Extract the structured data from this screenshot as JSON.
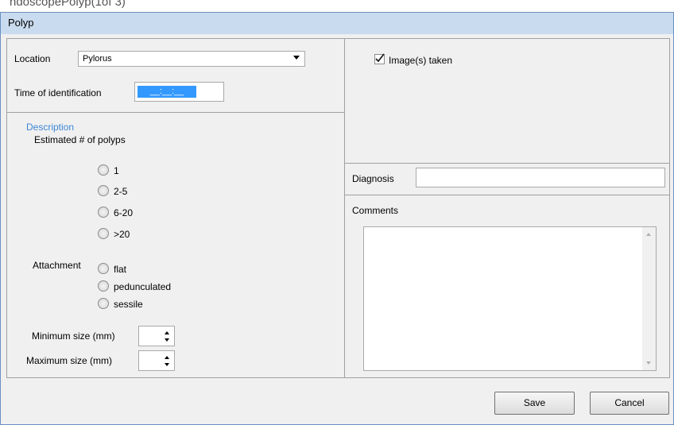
{
  "background_caption": "ndoscopePolyp(1of 3)",
  "window": {
    "title": "Polyp"
  },
  "location": {
    "label": "Location",
    "value": "Pylorus"
  },
  "time_of_identification": {
    "label": "Time of identification",
    "value": "__:__:__"
  },
  "description": {
    "heading": "Description",
    "estimated_label": "Estimated # of polyps",
    "estimated_options": [
      "1",
      "2-5",
      "6-20",
      ">20"
    ],
    "attachment_label": "Attachment",
    "attachment_options": [
      "flat",
      "pedunculated",
      "sessile"
    ],
    "min_size_label": "Minimum size  (mm)",
    "max_size_label": "Maximum size  (mm)"
  },
  "images_taken": {
    "label": "Image(s) taken",
    "checked": true
  },
  "diagnosis": {
    "label": "Diagnosis",
    "value": ""
  },
  "comments": {
    "label": "Comments",
    "value": ""
  },
  "buttons": {
    "save": "Save",
    "cancel": "Cancel"
  },
  "colors": {
    "accent": "#3399ff",
    "title_bar": "#c9dbee",
    "heading": "#3c86d6"
  }
}
